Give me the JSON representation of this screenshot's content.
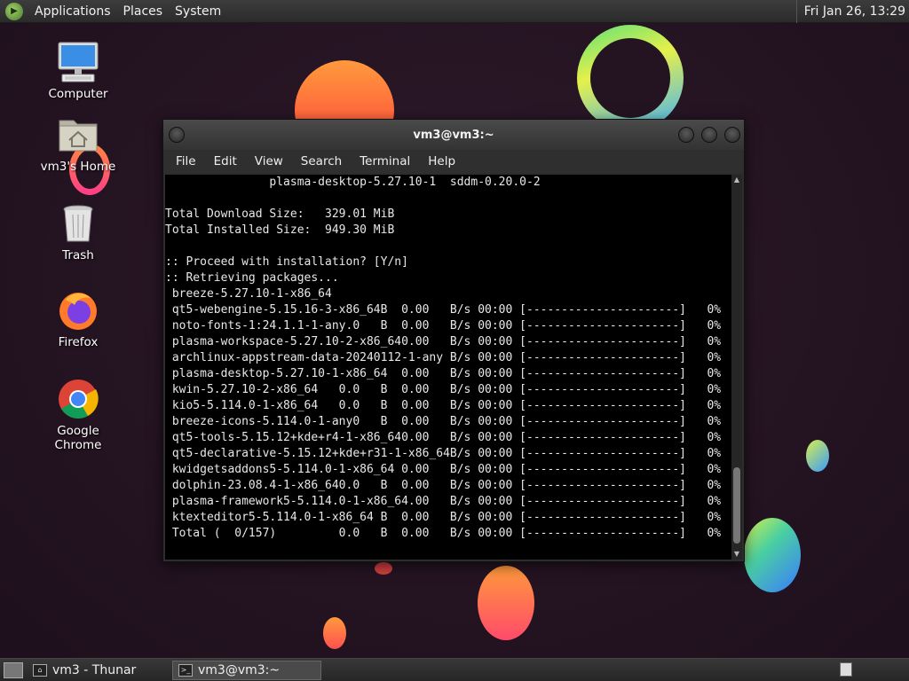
{
  "top_panel": {
    "menus": [
      "Applications",
      "Places",
      "System"
    ],
    "clock": "Fri Jan 26, 13:29"
  },
  "desktop_icons": [
    {
      "label": "Computer",
      "icon": "computer-icon"
    },
    {
      "label": "vm3's Home",
      "icon": "home-folder-icon"
    },
    {
      "label": "Trash",
      "icon": "trash-icon"
    },
    {
      "label": "Firefox",
      "icon": "firefox-icon"
    },
    {
      "label": "Google Chrome",
      "icon": "chrome-icon"
    }
  ],
  "terminal": {
    "title": "vm3@vm3:~",
    "menu": [
      "File",
      "Edit",
      "View",
      "Search",
      "Terminal",
      "Help"
    ],
    "lines": [
      "               plasma-desktop-5.27.10-1  sddm-0.20.0-2",
      "",
      "Total Download Size:   329.01 MiB",
      "Total Installed Size:  949.30 MiB",
      "",
      ":: Proceed with installation? [Y/n]",
      ":: Retrieving packages...",
      " breeze-5.27.10-1-x86_64",
      " qt5-webengine-5.15.16-3-x86_64B  0.00   B/s 00:00 [----------------------]   0%",
      " noto-fonts-1:24.1.1-1-any.0   B  0.00   B/s 00:00 [----------------------]   0%",
      " plasma-workspace-5.27.10-2-x86_640.00   B/s 00:00 [----------------------]   0%",
      " archlinux-appstream-data-20240112-1-any B/s 00:00 [----------------------]   0%",
      " plasma-desktop-5.27.10-1-x86_64  0.00   B/s 00:00 [----------------------]   0%",
      " kwin-5.27.10-2-x86_64   0.0   B  0.00   B/s 00:00 [----------------------]   0%",
      " kio5-5.114.0-1-x86_64   0.0   B  0.00   B/s 00:00 [----------------------]   0%",
      " breeze-icons-5.114.0-1-any0   B  0.00   B/s 00:00 [----------------------]   0%",
      " qt5-tools-5.15.12+kde+r4-1-x86_640.00   B/s 00:00 [----------------------]   0%",
      " qt5-declarative-5.15.12+kde+r31-1-x86_64B/s 00:00 [----------------------]   0%",
      " kwidgetsaddons5-5.114.0-1-x86_64 0.00   B/s 00:00 [----------------------]   0%",
      " dolphin-23.08.4-1-x86_640.0   B  0.00   B/s 00:00 [----------------------]   0%",
      " plasma-framework5-5.114.0-1-x86_64.00   B/s 00:00 [----------------------]   0%",
      " ktexteditor5-5.114.0-1-x86_64 B  0.00   B/s 00:00 [----------------------]   0%",
      " Total (  0/157)         0.0   B  0.00   B/s 00:00 [----------------------]   0%"
    ]
  },
  "taskbar": {
    "tasks": [
      {
        "label": "vm3 - Thunar",
        "icon": "file-manager-icon"
      },
      {
        "label": "vm3@vm3:~",
        "icon": "terminal-icon"
      }
    ]
  }
}
